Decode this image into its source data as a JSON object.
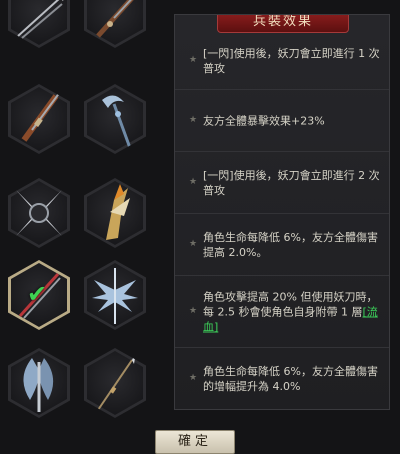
{
  "panel": {
    "title": "兵裝效果",
    "effects": [
      {
        "text": "[一閃]使用後，妖刀會立即進行 1 次普攻"
      },
      {
        "text": "友方全體暴擊效果+23%"
      },
      {
        "text": "[一閃]使用後，妖刀會立即進行 2 次普攻"
      },
      {
        "text": "角色生命每降低 6%，友方全體傷害提高 2.0%。"
      },
      {
        "text_main": "角色攻擊提高 20% 但使用妖刀時，每 2.5 秒會使角色自身附帶 1 層",
        "link": "[流血]"
      },
      {
        "text": "角色生命每降低 6%，友方全體傷害的增幅提升為 4.0%"
      }
    ]
  },
  "weapons": [
    {
      "icon": "twin-spear-icon"
    },
    {
      "icon": "rifle-icon"
    },
    {
      "icon": "musket-icon"
    },
    {
      "icon": "crescent-staff-icon"
    },
    {
      "icon": "shuriken-icon"
    },
    {
      "icon": "golden-blade-icon"
    },
    {
      "icon": "dual-dagger-icon",
      "selected": true
    },
    {
      "icon": "ice-wings-icon"
    },
    {
      "icon": "battle-axe-icon"
    },
    {
      "icon": "long-spear-icon"
    }
  ],
  "check_icon": "checkmark-icon",
  "check_glyph": "✔",
  "confirm_label": "確定",
  "colors": {
    "header": "#8e1e1e",
    "link": "#3cd05a",
    "check": "#3ed152"
  }
}
